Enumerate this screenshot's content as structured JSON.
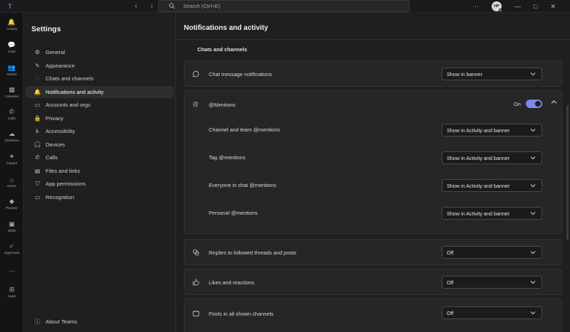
{
  "titlebar": {
    "logo": "T",
    "back_icon": "chevron-left-icon",
    "forward_icon": "chevron-right-icon",
    "search_placeholder": "Search (Ctrl+E)",
    "more": "···",
    "avatar_initials": "HP",
    "minimize": "—",
    "maximize": "□",
    "close": "✕"
  },
  "rail": [
    {
      "label": "Activity",
      "icon": "bell-icon",
      "glyph": "🔔"
    },
    {
      "label": "Chat",
      "icon": "chat-icon",
      "glyph": "💬"
    },
    {
      "label": "Teams",
      "icon": "teams-icon",
      "glyph": "👥"
    },
    {
      "label": "Calendar",
      "icon": "calendar-icon",
      "glyph": "▦"
    },
    {
      "label": "Calls",
      "icon": "phone-icon",
      "glyph": "✆"
    },
    {
      "label": "OneDrive",
      "icon": "cloud-icon",
      "glyph": "☁"
    },
    {
      "label": "Copilot",
      "icon": "copilot-icon",
      "glyph": "✦"
    },
    {
      "label": "Home",
      "icon": "home-icon",
      "glyph": "⌂"
    },
    {
      "label": "Planner",
      "icon": "planner-icon",
      "glyph": "◆"
    },
    {
      "label": "Shifts",
      "icon": "shifts-icon",
      "glyph": "▣"
    },
    {
      "label": "Approvals",
      "icon": "approvals-icon",
      "glyph": "✓"
    },
    {
      "label": "",
      "icon": "more-icon",
      "glyph": "···"
    },
    {
      "label": "Apps",
      "icon": "apps-icon",
      "glyph": "⊞"
    }
  ],
  "settings": {
    "title": "Settings",
    "items": [
      {
        "label": "General",
        "icon": "gear-icon",
        "glyph": "⚙"
      },
      {
        "label": "Appearance",
        "icon": "wand-icon",
        "glyph": "✎"
      },
      {
        "label": "Chats and channels",
        "icon": "chat-icon",
        "glyph": "◌"
      },
      {
        "label": "Notifications and activity",
        "icon": "bell-icon",
        "glyph": "🔔",
        "active": true
      },
      {
        "label": "Accounts and orgs",
        "icon": "id-card-icon",
        "glyph": "▭"
      },
      {
        "label": "Privacy",
        "icon": "lock-icon",
        "glyph": "🔒"
      },
      {
        "label": "Accessibility",
        "icon": "accessibility-icon",
        "glyph": "♿"
      },
      {
        "label": "Devices",
        "icon": "headset-icon",
        "glyph": "🎧"
      },
      {
        "label": "Calls",
        "icon": "phone-icon",
        "glyph": "✆"
      },
      {
        "label": "Files and links",
        "icon": "file-icon",
        "glyph": "▤"
      },
      {
        "label": "App permissions",
        "icon": "shield-icon",
        "glyph": "⛉"
      },
      {
        "label": "Recognition",
        "icon": "recognition-icon",
        "glyph": "▭"
      }
    ],
    "about": {
      "label": "About Teams",
      "icon": "info-icon",
      "glyph": "ⓘ"
    }
  },
  "main": {
    "title": "Notifications and activity",
    "section": "Chats and channels",
    "chat_msg": {
      "label": "Chat message notifications",
      "value": "Show in banner"
    },
    "mentions": {
      "label": "@Mentions",
      "toggle_label": "On",
      "toggle_on": true,
      "rows": [
        {
          "label": "Channel and team @mentions",
          "value": "Show in Activity and banner"
        },
        {
          "label": "Tag @mentions",
          "value": "Show in Activity and banner"
        },
        {
          "label": "Everyone in chat @mentions",
          "value": "Show in Activity and banner"
        },
        {
          "label": "Personal @mentions",
          "value": "Show in Activity and banner"
        }
      ]
    },
    "replies": {
      "label": "Replies to followed threads and posts",
      "value": "Off"
    },
    "likes": {
      "label": "Likes and reactions",
      "value": "Off"
    },
    "posts": {
      "label": "Posts in all shown channels",
      "value": "Off"
    }
  },
  "colors": {
    "accent": "#7f86ea",
    "background": "#1f1f1f",
    "card": "#262626",
    "presence": "#6bb700"
  }
}
